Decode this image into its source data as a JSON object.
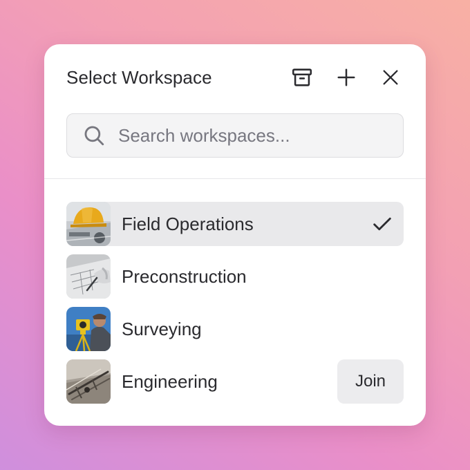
{
  "header": {
    "title": "Select Workspace",
    "actions": [
      {
        "name": "archive-icon"
      },
      {
        "name": "plus-icon"
      },
      {
        "name": "close-icon"
      }
    ]
  },
  "search": {
    "placeholder": "Search workspaces...",
    "value": "",
    "icon": "search-icon"
  },
  "workspaces": [
    {
      "label": "Field Operations",
      "selected": true,
      "thumbnail": "hard-hat-photo",
      "action": "check-icon"
    },
    {
      "label": "Preconstruction",
      "selected": false,
      "thumbnail": "blueprint-drawing-photo"
    },
    {
      "label": "Surveying",
      "selected": false,
      "thumbnail": "surveyor-theodolite-photo"
    },
    {
      "label": "Engineering",
      "selected": false,
      "thumbnail": "drafting-tools-photo",
      "join_label": "Join"
    }
  ],
  "colors": {
    "panel": "#ffffff",
    "selected_row": "#e9e9eb",
    "join_button": "#ececee",
    "text": "#2a2a2e"
  }
}
